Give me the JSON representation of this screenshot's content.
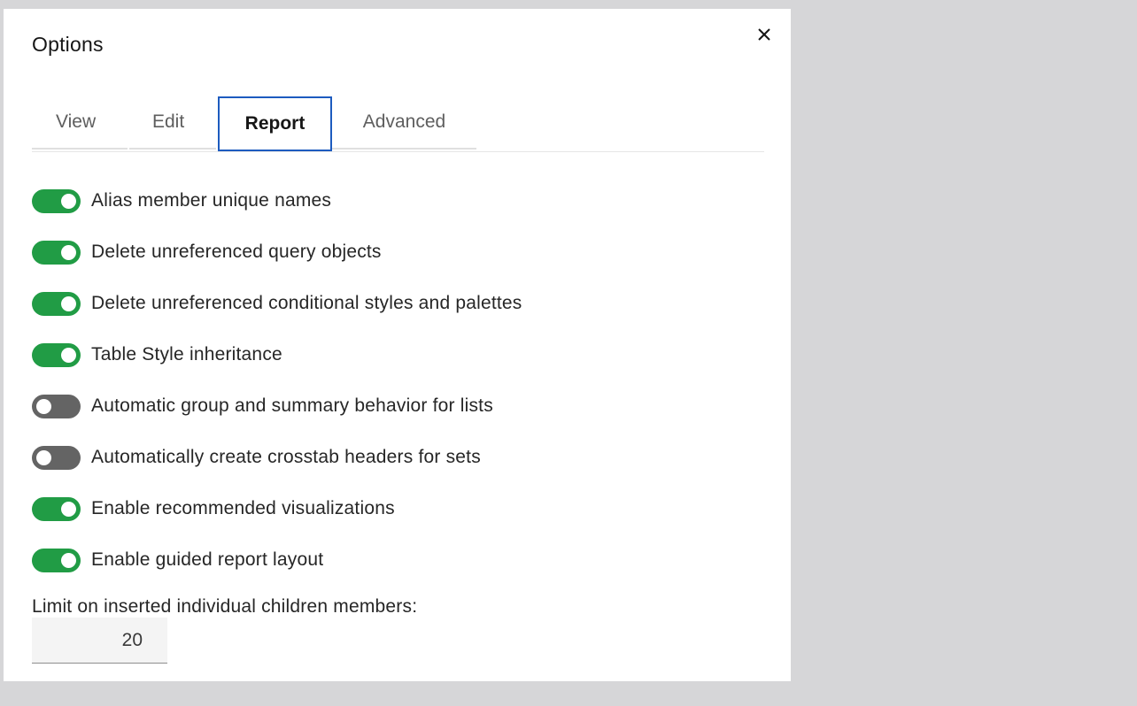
{
  "dialog": {
    "title": "Options",
    "close_icon": "close-icon"
  },
  "tabs": [
    {
      "label": "View",
      "selected": false
    },
    {
      "label": "Edit",
      "selected": false
    },
    {
      "label": "Report",
      "selected": true
    },
    {
      "label": "Advanced",
      "selected": false
    }
  ],
  "options": [
    {
      "label": "Alias member unique names",
      "on": true
    },
    {
      "label": "Delete unreferenced query objects",
      "on": true
    },
    {
      "label": "Delete unreferenced conditional styles and palettes",
      "on": true
    },
    {
      "label": "Table Style inheritance",
      "on": true
    },
    {
      "label": "Automatic group and summary behavior for lists",
      "on": false
    },
    {
      "label": "Automatically create crosstab headers for sets",
      "on": false
    },
    {
      "label": "Enable recommended visualizations",
      "on": true
    },
    {
      "label": "Enable guided report layout",
      "on": true
    }
  ],
  "limit": {
    "label": "Limit on inserted individual children members:",
    "value": "20"
  },
  "colors": {
    "toggle_on": "#219c45",
    "toggle_off": "#646464",
    "tab_focus_border": "#1d5bbf"
  }
}
